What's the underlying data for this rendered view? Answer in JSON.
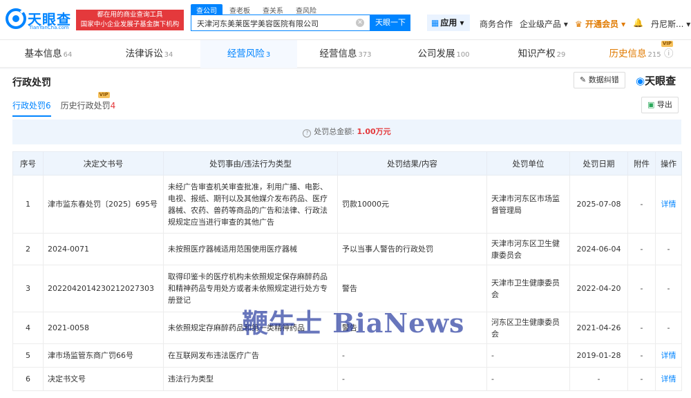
{
  "header": {
    "logo_cn": "天眼查",
    "logo_en": "TianYanCha.com",
    "slogan_line1": "都在用的商业查询工具",
    "slogan_line2": "国家中小企业发展子基金旗下机构",
    "search_tabs": [
      "查公司",
      "查老板",
      "查关系",
      "查风险"
    ],
    "search_value": "天津河东美莱医学美容医院有限公司",
    "search_button": "天眼一下",
    "app_button": "应用",
    "nav": [
      "商务合作",
      "企业级产品",
      "开通会员",
      "丹尼斯..."
    ]
  },
  "tabs": [
    {
      "label": "基本信息",
      "count": "64"
    },
    {
      "label": "法律诉讼",
      "count": "34"
    },
    {
      "label": "经营风险",
      "count": "3"
    },
    {
      "label": "经营信息",
      "count": "373"
    },
    {
      "label": "公司发展",
      "count": "100"
    },
    {
      "label": "知识产权",
      "count": "29"
    },
    {
      "label": "历史信息",
      "count": "215",
      "badge": "VIP"
    }
  ],
  "section": {
    "title": "行政处罚",
    "report_button": "数据纠错",
    "brand": "天眼查",
    "export_button": "导出",
    "subtabs": [
      {
        "label": "行政处罚",
        "num": "6"
      },
      {
        "label": "历史行政处罚",
        "num": "4",
        "badge": "VIP"
      }
    ],
    "summary_label": "处罚总金额:",
    "summary_amount": "1.00万元"
  },
  "table": {
    "headers": [
      "序号",
      "决定文书号",
      "处罚事由/违法行为类型",
      "处罚结果/内容",
      "处罚单位",
      "处罚日期",
      "附件",
      "操作"
    ],
    "rows": [
      [
        "1",
        "津市监东春处罚〔2025〕695号",
        "未经广告审查机关审查批准，利用广播、电影、电视、报纸、期刊以及其他媒介发布药品、医疗器械、农药、兽药等商品的广告和法律、行政法规规定应当进行审查的其他广告",
        "罚款10000元",
        "天津市河东区市场监督管理局",
        "2025-07-08",
        "-",
        "详情"
      ],
      [
        "2",
        "2024-0071",
        "未按照医疗器械适用范围使用医疗器械",
        "予以当事人警告的行政处罚",
        "天津市河东区卫生健康委员会",
        "2024-06-04",
        "-",
        "-"
      ],
      [
        "3",
        "2022042014230212027303",
        "取得印鉴卡的医疗机构未依照规定保存麻醉药品和精神药品专用处方或者未依照规定进行处方专册登记",
        "警告",
        "天津市卫生健康委员会",
        "2022-04-20",
        "-",
        "-"
      ],
      [
        "4",
        "2021-0058",
        "未依照规定存麻醉药品和第一类精神药品",
        "警告",
        "河东区卫生健康委员会",
        "2021-04-26",
        "-",
        "-"
      ],
      [
        "5",
        "津市场监管东商广罚66号",
        "在互联网发布违法医疗广告",
        "-",
        "-",
        "2019-01-28",
        "-",
        "详情"
      ],
      [
        "6",
        "决定书文号",
        "违法行为类型",
        "-",
        "-",
        "-",
        "-",
        "详情"
      ]
    ]
  },
  "watermark": "鞭牛士 BiaNews"
}
